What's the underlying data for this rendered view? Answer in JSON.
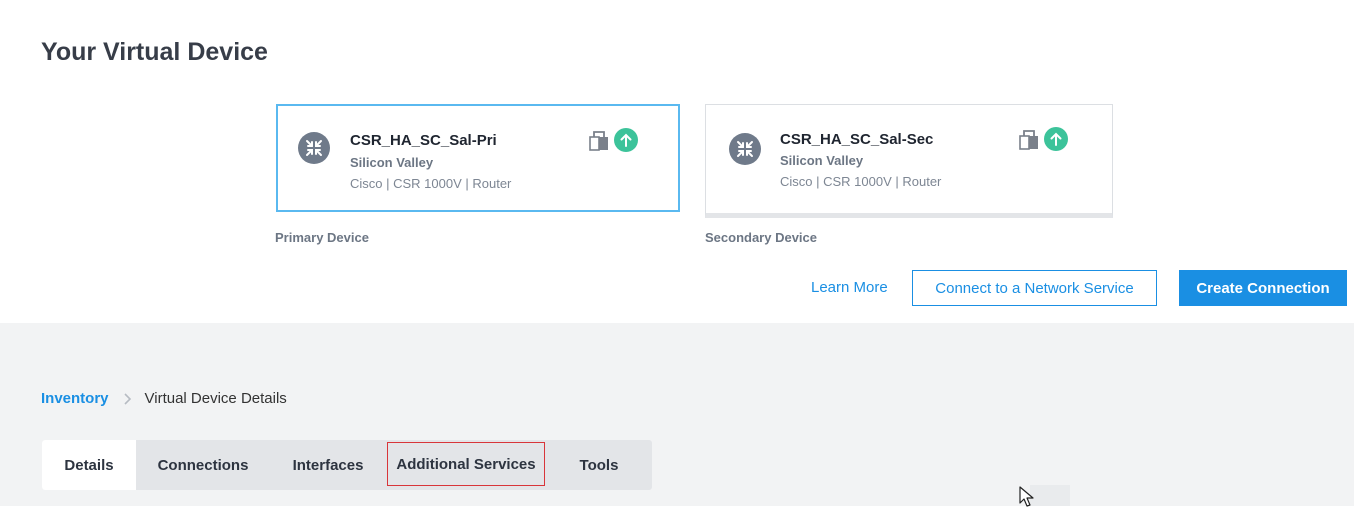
{
  "header": {
    "title": "Your Virtual Device"
  },
  "devices": [
    {
      "name": "CSR_HA_SC_Sal-Pri",
      "location": "Silicon Valley",
      "meta": "Cisco | CSR 1000V | Router",
      "label": "Primary Device",
      "device_icon": "router-icon",
      "status_icons": [
        "lock-icon",
        "arrow-up-icon"
      ],
      "status_color": "#3cc39a"
    },
    {
      "name": "CSR_HA_SC_Sal-Sec",
      "location": "Silicon Valley",
      "meta": "Cisco | CSR 1000V | Router",
      "label": "Secondary Device",
      "device_icon": "router-icon",
      "status_icons": [
        "lock-icon",
        "arrow-up-icon"
      ],
      "status_color": "#3cc39a"
    }
  ],
  "actions": {
    "learn_more": "Learn More",
    "connect_network_service": "Connect to a Network Service",
    "create_connection": "Create Connection"
  },
  "breadcrumb": {
    "root": "Inventory",
    "current": "Virtual Device Details",
    "separator_icon": "chevron-right-icon"
  },
  "tabs": [
    {
      "label": "Details",
      "active": true
    },
    {
      "label": "Connections",
      "active": false
    },
    {
      "label": "Interfaces",
      "active": false
    },
    {
      "label": "Additional Services",
      "active": false,
      "highlighted": true
    },
    {
      "label": "Tools",
      "active": false
    }
  ],
  "colors": {
    "accent": "#1a8fe3",
    "selected_border": "#5ab9f0",
    "status_up": "#3cc39a",
    "highlight_outline": "#d8353a"
  }
}
